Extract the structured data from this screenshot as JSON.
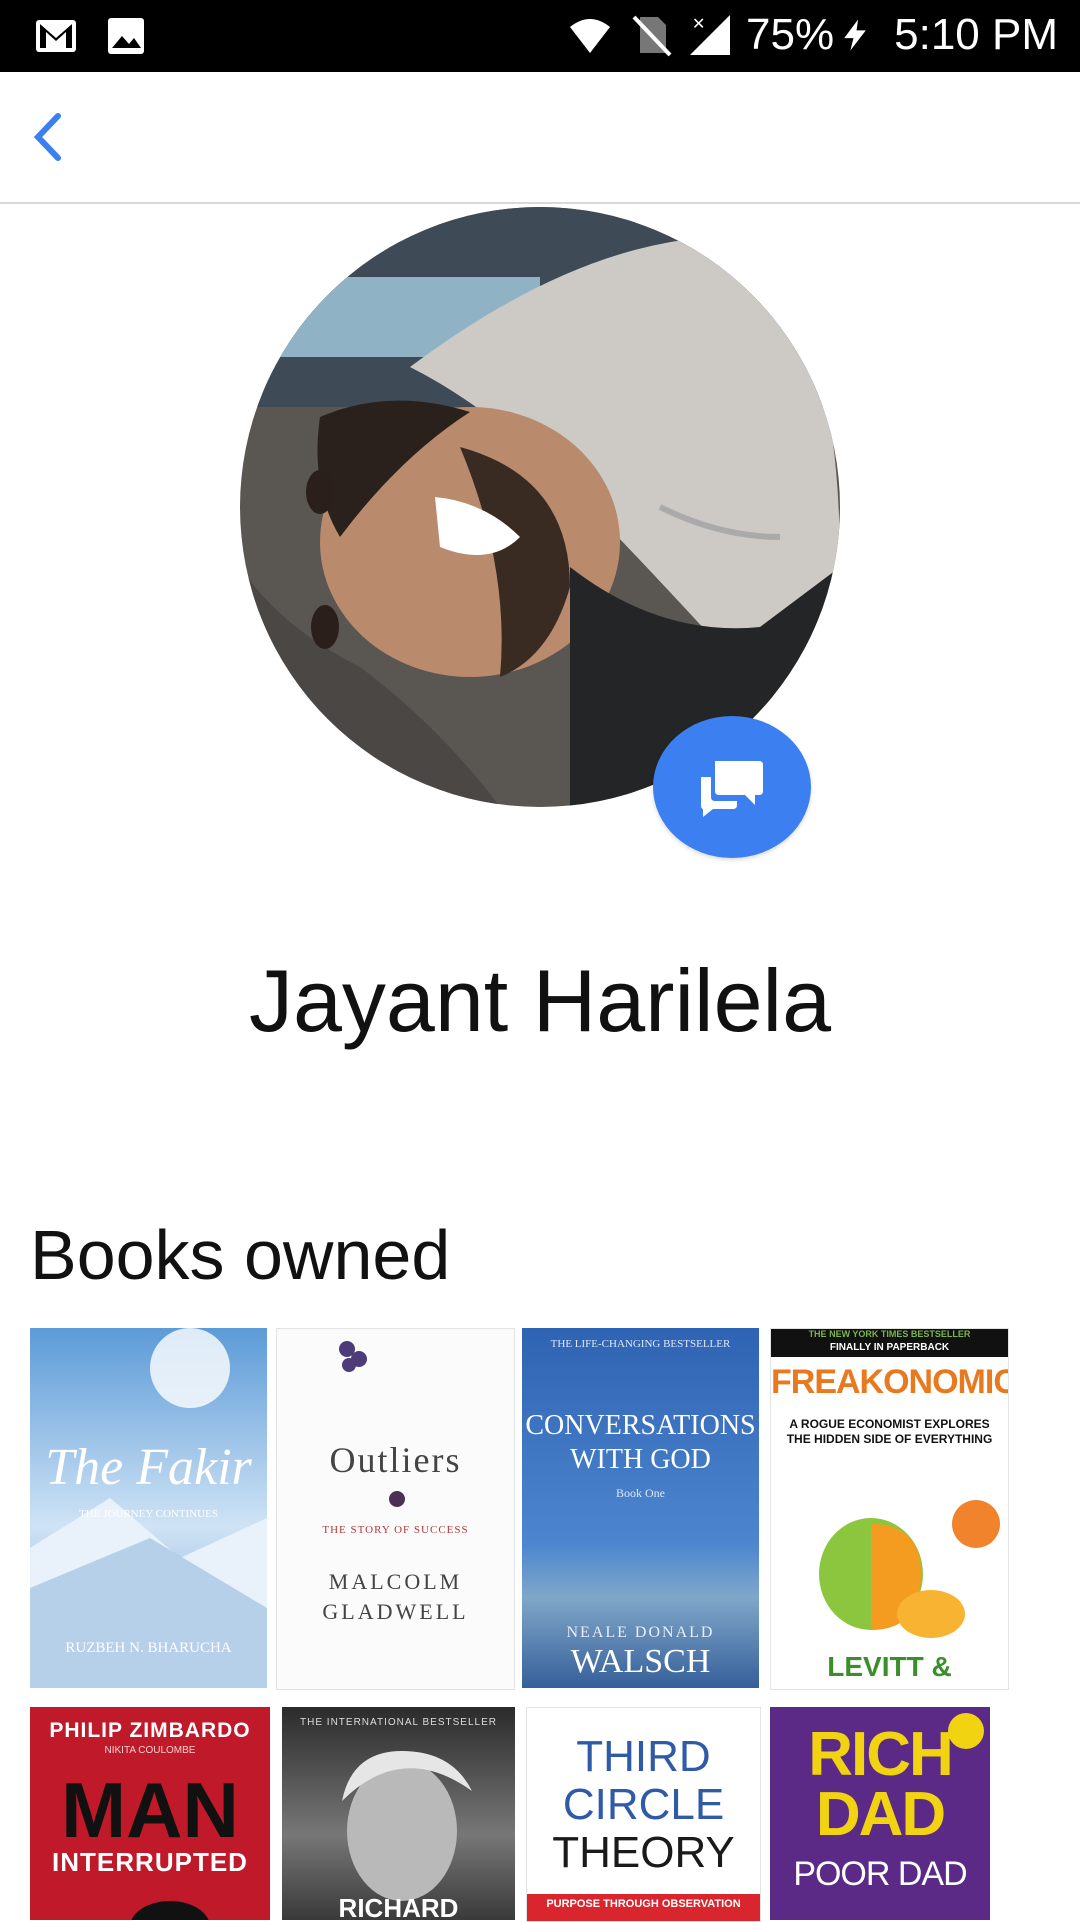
{
  "status_bar": {
    "battery": "75%",
    "time": "5:10 PM"
  },
  "profile": {
    "name": "Jayant Harilela"
  },
  "books_section": {
    "title": "Books owned",
    "books": [
      {
        "title": "The Fakir",
        "subtitle": "THE JOURNEY CONTINUES",
        "author": "RUZBEH N. BHARUCHA"
      },
      {
        "title": "Outliers",
        "subtitle": "THE STORY OF SUCCESS",
        "author_line1": "MALCOLM",
        "author_line2": "GLADWELL"
      },
      {
        "banner": "THE LIFE-CHANGING BESTSELLER",
        "title_line1": "CONVERSATIONS",
        "title_line2": "WITH GOD",
        "book": "Book One",
        "author_line1": "NEALE DONALD",
        "author_line2": "WALSCH"
      },
      {
        "banner": "THE NEW YORK TIMES BESTSELLER",
        "banner2": "FINALLY IN PAPERBACK",
        "title": "FREAKONOMICS",
        "subtitle": "A ROGUE ECONOMIST EXPLORES THE HIDDEN SIDE OF EVERYTHING",
        "author": "LEVITT & DUBNER"
      },
      {
        "author": "PHILIP ZIMBARDO",
        "coauthor": "NIKITA COULOMBE",
        "title": "MAN",
        "title2": "INTERRUPTED"
      },
      {
        "banner": "THE INTERNATIONAL BESTSELLER",
        "author": "RICHARD"
      },
      {
        "title_line1": "THIRD",
        "title_line2": "CIRCLE",
        "title_line3": "THEORY",
        "subtitle": "PURPOSE THROUGH OBSERVATION"
      },
      {
        "title_line1": "RICH",
        "title_line2": "DAD",
        "title_line3": "POOR DAD"
      }
    ]
  }
}
